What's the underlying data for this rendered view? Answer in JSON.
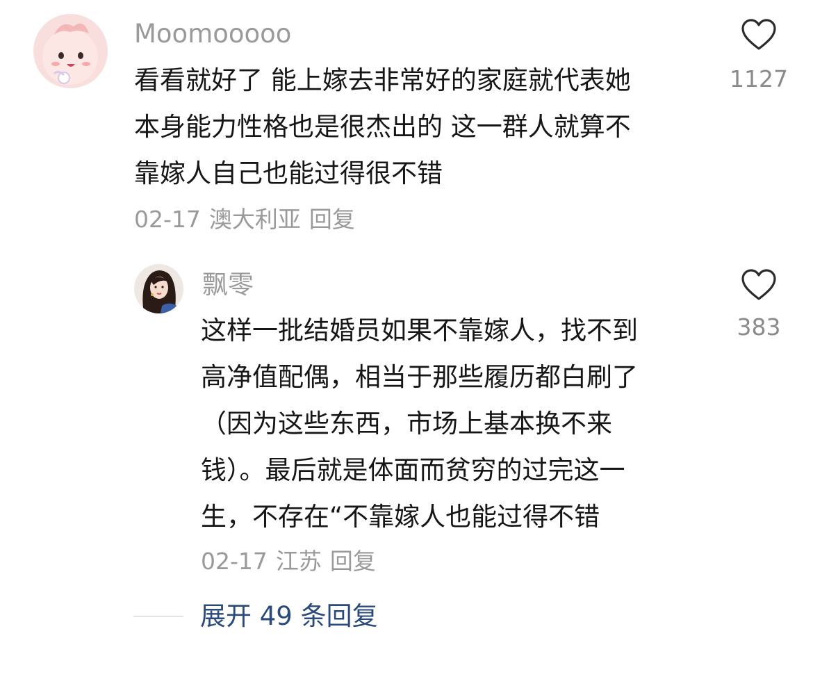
{
  "comments": [
    {
      "username": "Moomooooo",
      "avatar": "pink-cartoon-avatar",
      "lines": [
        "看看就好了 能上嫁去非常好的家庭就代表她",
        "本身能力性格也是很杰出的 这一群人就算不",
        "靠嫁人自己也能过得很不错"
      ],
      "date": "02-17",
      "location": "澳大利亚",
      "reply_label": "回复",
      "likes": "1127"
    },
    {
      "username": "飘零",
      "avatar": "illustrated-woman-avatar",
      "lines": [
        "这样一批结婚员如果不靠嫁人，找不到",
        "高净值配偶，相当于那些履历都白刷了",
        "（因为这些东西，市场上基本换不来",
        "钱）。最后就是体面而贫穷的过完这一",
        "生，不存在“不靠嫁人也能过得不错"
      ],
      "date": "02-17",
      "location": "江苏",
      "reply_label": "回复",
      "likes": "383"
    }
  ],
  "expand_label": "展开 49 条回复",
  "colors": {
    "text": "#161616",
    "muted": "#9a9a9a",
    "link": "#2b4a7c",
    "avatar_pink": "#f8dcdc"
  },
  "icons": [
    "heart-icon"
  ]
}
